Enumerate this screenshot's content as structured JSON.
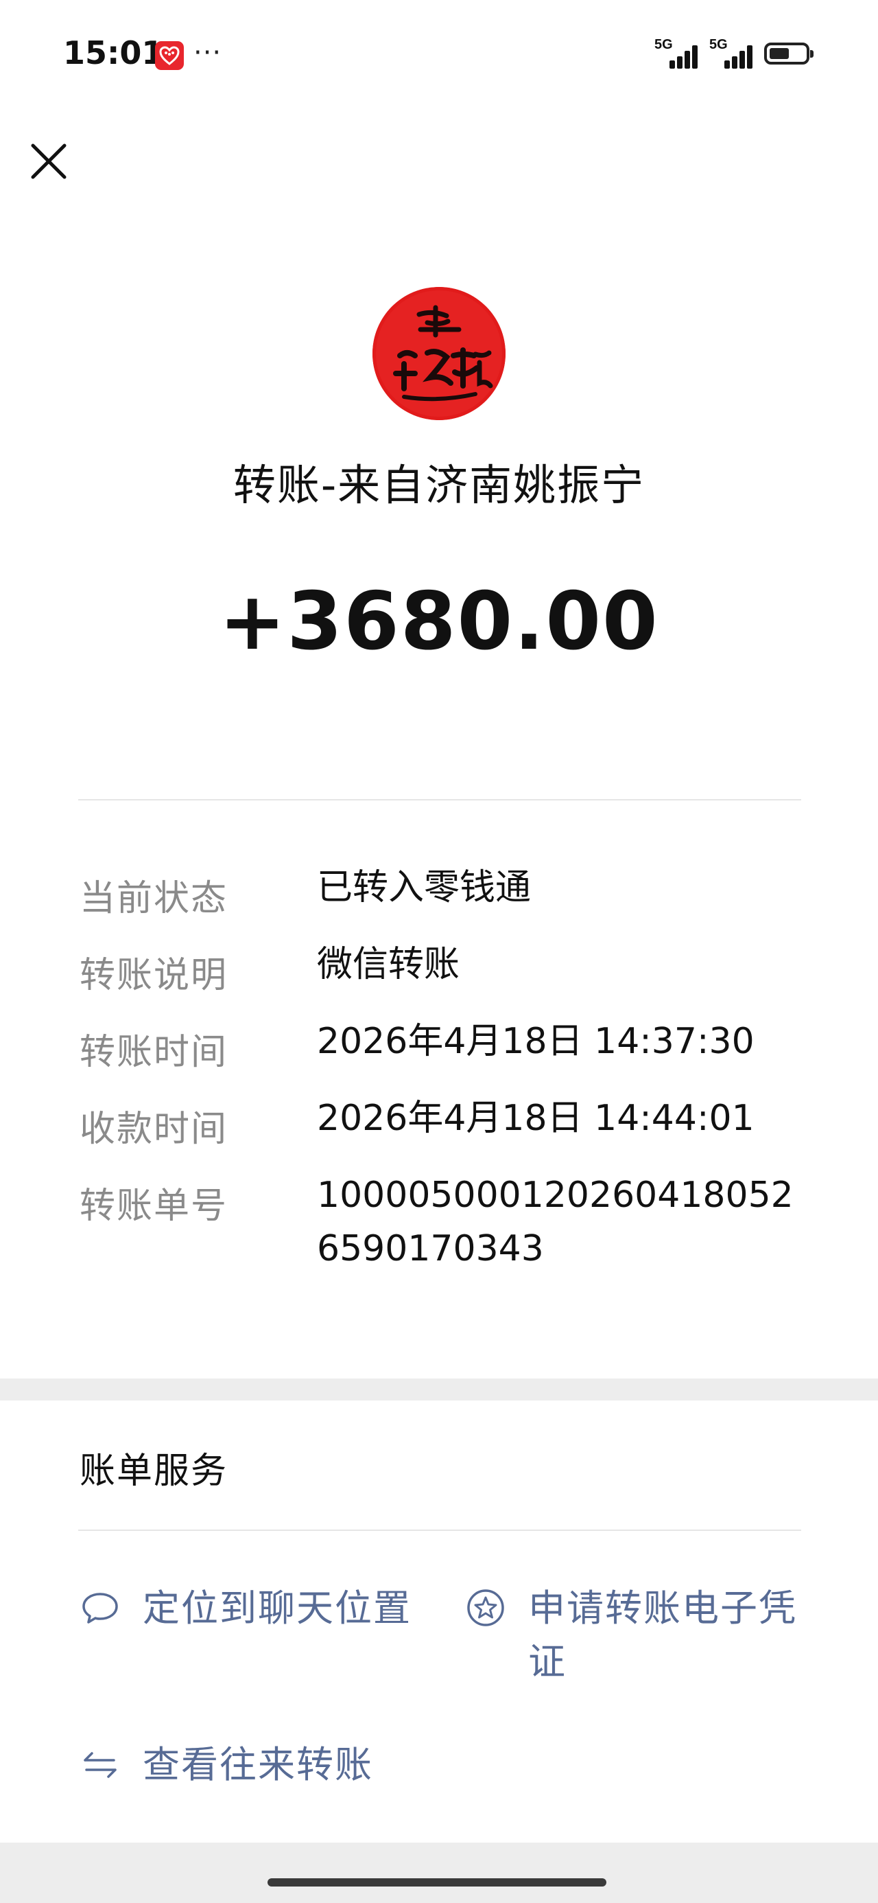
{
  "status_bar": {
    "time": "15:01",
    "app_icon": "heart-app-icon",
    "more": "···",
    "signal_1_label": "5G",
    "signal_2_label": "5G",
    "battery_level": 0.55
  },
  "header": {
    "close_icon": "close-icon",
    "avatar_icon": "avatar-red-calligraphy",
    "title": "转账-来自济南姚振宁",
    "amount": "+3680.00"
  },
  "details": [
    {
      "label": "当前状态",
      "value": "已转入零钱通"
    },
    {
      "label": "转账说明",
      "value": "微信转账"
    },
    {
      "label": "转账时间",
      "value": "2026年4月18日 14:37:30"
    },
    {
      "label": "收款时间",
      "value": "2026年4月18日 14:44:01"
    },
    {
      "label": "转账单号",
      "value": "100005000120260418052 6590170343"
    }
  ],
  "services": {
    "title": "账单服务",
    "locate_chat": {
      "label": "定位到聊天位置",
      "icon": "chat-bubble-icon"
    },
    "apply_voucher": {
      "label": "申请转账电子凭证",
      "icon": "star-circle-icon"
    },
    "view_transfers": {
      "label": "查看往来转账",
      "icon": "swap-arrows-icon"
    }
  },
  "colors": {
    "link": "#576b95",
    "label_gray": "#8a8a8a",
    "avatar_red": "#e11b1b"
  }
}
